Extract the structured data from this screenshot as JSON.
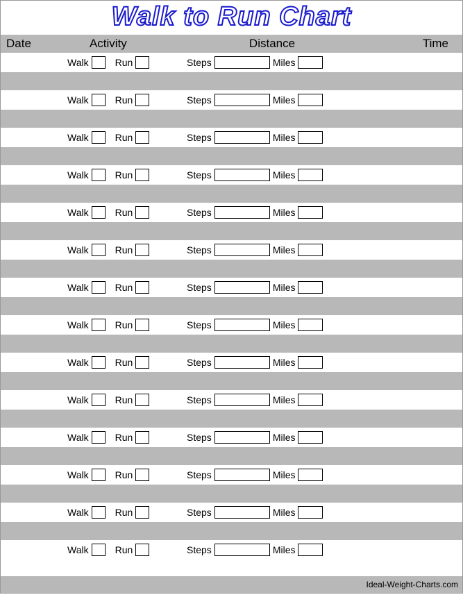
{
  "title": "Walk to Run Chart",
  "headers": {
    "date": "Date",
    "activity": "Activity",
    "distance": "Distance",
    "time": "Time"
  },
  "labels": {
    "walk": "Walk",
    "run": "Run",
    "steps": "Steps",
    "miles": "Miles"
  },
  "footer": "Ideal-Weight-Charts.com",
  "row_count": 14
}
